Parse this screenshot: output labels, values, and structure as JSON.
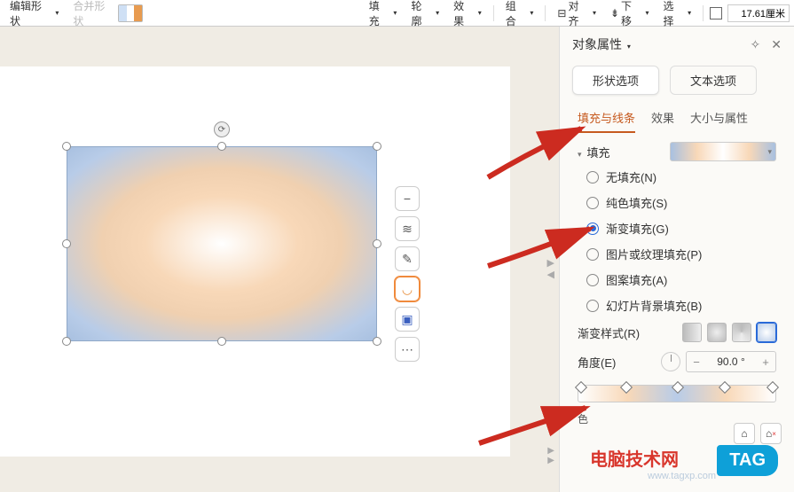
{
  "toolbar": {
    "edit_shape": "编辑形状",
    "merge_shape": "合并形状",
    "fill": "填充",
    "outline": "轮廓",
    "effect": "效果",
    "group": "组合",
    "align": "对齐",
    "move_down": "下移",
    "select": "选择",
    "width_val": "17.61厘米"
  },
  "panel": {
    "title": "对象属性",
    "pin_icon": "pin",
    "close_icon": "close",
    "tab_shape": "形状选项",
    "tab_text": "文本选项",
    "sub_fill": "填充与线条",
    "sub_effect": "效果",
    "sub_size": "大小与属性",
    "section_fill": "填充",
    "radio_none": "无填充(N)",
    "radio_solid": "纯色填充(S)",
    "radio_gradient": "渐变填充(G)",
    "radio_picture": "图片或纹理填充(P)",
    "radio_pattern": "图案填充(A)",
    "radio_slide_bg": "幻灯片背景填充(B)",
    "grad_style_label": "渐变样式(R)",
    "angle_label": "角度(E)",
    "angle_value": "90.0 °",
    "color_label": "色"
  },
  "watermark": {
    "site": "电脑技术网",
    "url": "www.tagxp.com",
    "tag": "TAG"
  }
}
